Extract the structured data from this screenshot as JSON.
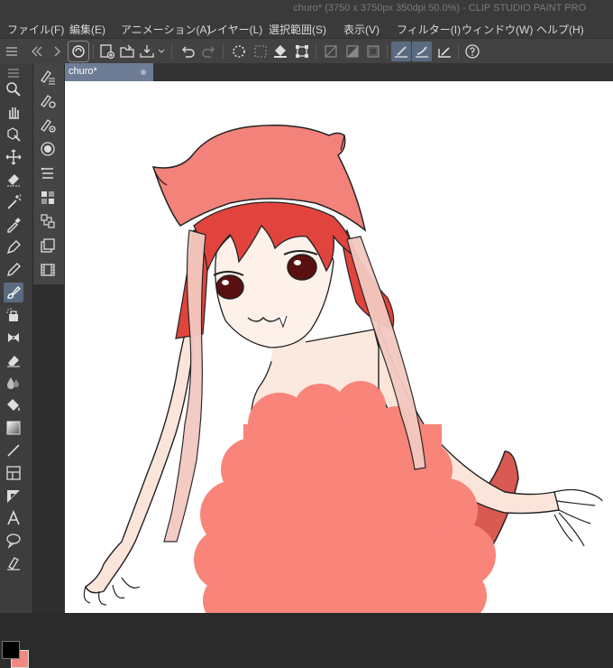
{
  "window": {
    "title": "churo* (3750 x 3750px 350dpi 50.0%)  - CLIP STUDIO PAINT PRO"
  },
  "menu": [
    {
      "label": "ファイル(F)"
    },
    {
      "label": "編集(E)"
    },
    {
      "label": "アニメーション(A)"
    },
    {
      "label": "レイヤー(L)"
    },
    {
      "label": "選択範囲(S)"
    },
    {
      "label": "表示(V)"
    },
    {
      "label": "フィルター(I)"
    },
    {
      "label": "ウィンドウ(W)"
    },
    {
      "label": "ヘルプ(H)"
    }
  ],
  "tabs": [
    {
      "label": "churo*"
    }
  ],
  "colors": {
    "main_color": "#000000",
    "sub_color": "#f08a80",
    "accent": "#6e7d95"
  },
  "toolbar_icons": [
    "clip-studio-icon",
    "new-canvas-icon",
    "open-icon",
    "save-icon",
    "undo-icon",
    "redo-icon",
    "select-all-icon",
    "deselect-icon",
    "fill-icon",
    "transform-icon",
    "clear-icon",
    "fill-selection-icon",
    "invert-selection-icon",
    "ruler-snap-icon",
    "special-ruler-snap-icon",
    "grid-snap-icon",
    "help-icon"
  ]
}
